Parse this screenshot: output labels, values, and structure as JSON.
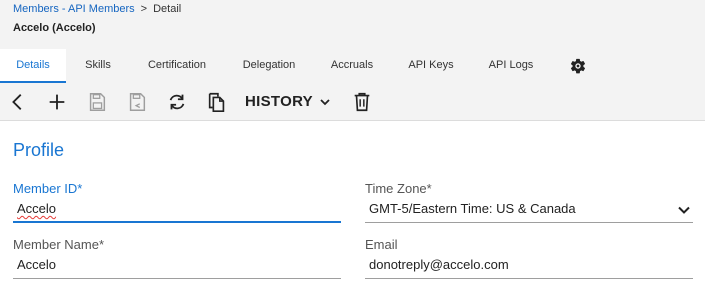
{
  "breadcrumb": {
    "link": "Members - API Members",
    "separator": ">",
    "current": "Detail"
  },
  "subtitle": "Accelo (Accelo)",
  "tabs": [
    {
      "label": "Details",
      "active": true
    },
    {
      "label": "Skills"
    },
    {
      "label": "Certification"
    },
    {
      "label": "Delegation"
    },
    {
      "label": "Accruals"
    },
    {
      "label": "API Keys"
    },
    {
      "label": "API Logs"
    }
  ],
  "toolbar": {
    "history_label": "HISTORY",
    "icons": [
      "back-icon",
      "add-icon",
      "save-icon",
      "save-as-icon",
      "refresh-icon",
      "copy-icon",
      "chevron-down-icon",
      "delete-icon"
    ]
  },
  "profile": {
    "title": "Profile",
    "member_id": {
      "label": "Member ID*",
      "value": "Accelo"
    },
    "member_name": {
      "label": "Member Name*",
      "value": "Accelo"
    },
    "time_zone": {
      "label": "Time Zone*",
      "value": "GMT-5/Eastern Time: US & Canada"
    },
    "email": {
      "label": "Email",
      "value": "donotreply@accelo.com"
    }
  },
  "colors": {
    "accent": "#1976d2",
    "header_bg": "#f3f3f3",
    "spellcheck": "#e53935"
  }
}
